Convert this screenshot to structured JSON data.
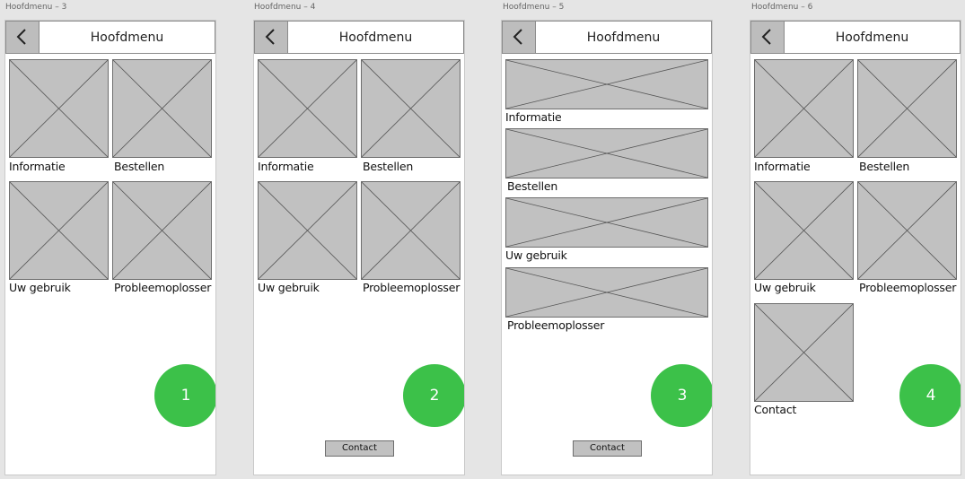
{
  "artboards": [
    {
      "name": "Hoofdmenu – 3",
      "title": "Hoofdmenu",
      "tiles": [
        "Informatie",
        "Bestellen",
        "Uw gebruik",
        "Probleemoplosser"
      ],
      "badge": "1"
    },
    {
      "name": "Hoofdmenu – 4",
      "title": "Hoofdmenu",
      "tiles": [
        "Informatie",
        "Bestellen",
        "Uw gebruik",
        "Probleemoplosser"
      ],
      "badge": "2",
      "contact_button": "Contact"
    },
    {
      "name": "Hoofdmenu – 5",
      "title": "Hoofdmenu",
      "tiles": [
        "Informatie",
        "Bestellen",
        "Uw gebruik",
        "Probleemoplosser"
      ],
      "badge": "3",
      "contact_button": "Contact"
    },
    {
      "name": "Hoofdmenu – 6",
      "title": "Hoofdmenu",
      "tiles": [
        "Informatie",
        "Bestellen",
        "Uw gebruik",
        "Probleemoplosser",
        "Contact"
      ],
      "badge": "4"
    }
  ],
  "icons": {
    "back": "chevron-left-icon",
    "image_placeholder": "image-placeholder-icon"
  },
  "colors": {
    "badge": "#3cc149",
    "placeholder": "#c1c1c1"
  }
}
